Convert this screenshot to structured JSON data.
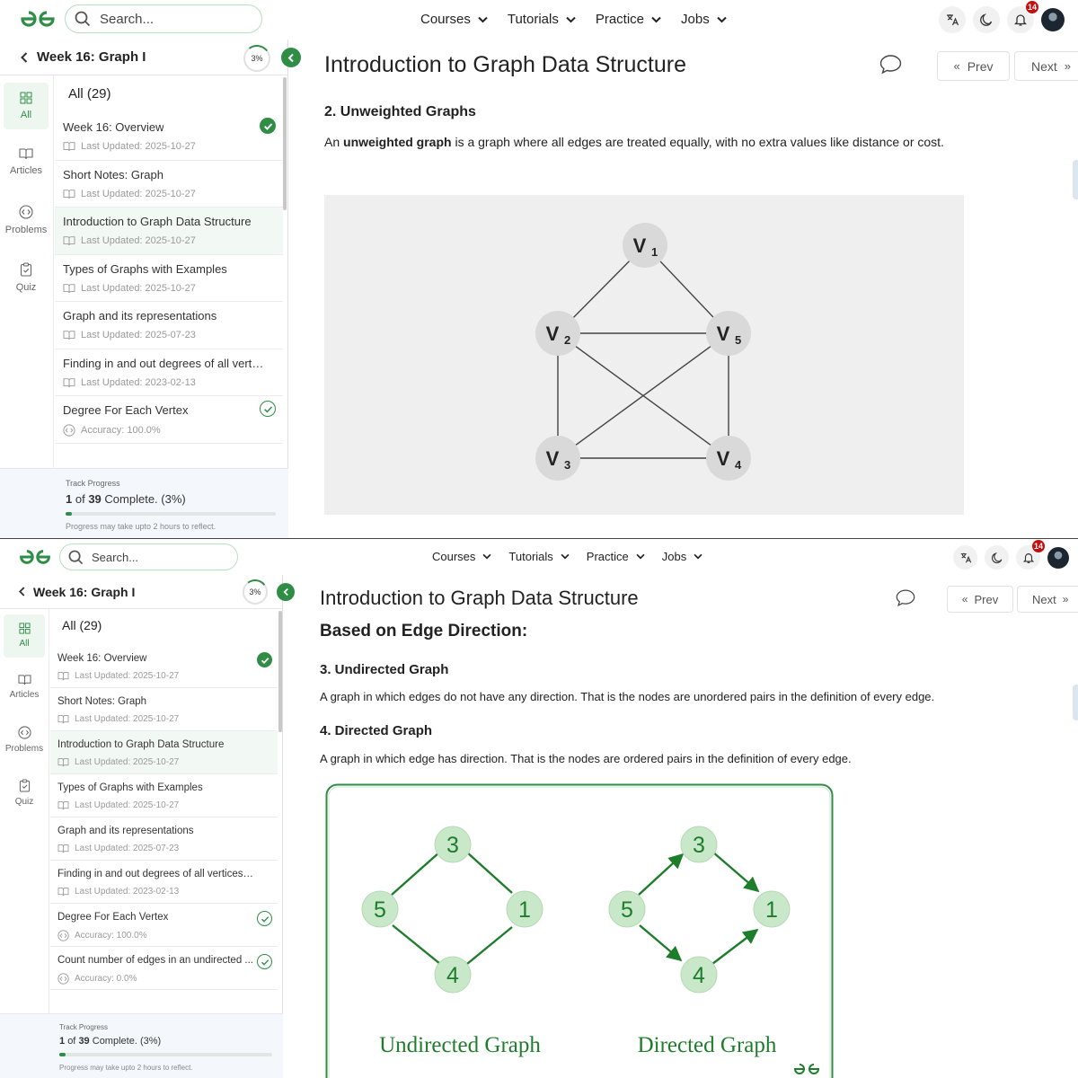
{
  "header": {
    "search_placeholder": "Search...",
    "nav": [
      "Courses",
      "Tutorials",
      "Practice",
      "Jobs"
    ],
    "notification_count": "14",
    "brand_color": "#2f8d46"
  },
  "sidebar": {
    "title": "Week 16: Graph I",
    "progress_percent": "3%",
    "rail": [
      "All",
      "Articles",
      "Problems",
      "Quiz"
    ],
    "all_label": "All (29)",
    "items_top": [
      {
        "title": "Week 16: Overview",
        "meta": "Last Updated: 2025-10-27",
        "icon": "book-icon",
        "status": "done"
      },
      {
        "title": "Short Notes: Graph",
        "meta": "Last Updated: 2025-10-27",
        "icon": "book-icon",
        "status": "none"
      },
      {
        "title": "Introduction to Graph Data Structure",
        "meta": "Last Updated: 2025-10-27",
        "icon": "book-icon",
        "status": "selected"
      },
      {
        "title": "Types of Graphs with Examples",
        "meta": "Last Updated: 2025-10-27",
        "icon": "book-icon",
        "status": "none"
      },
      {
        "title": "Graph and its representations",
        "meta": "Last Updated: 2025-07-23",
        "icon": "book-icon",
        "status": "none"
      },
      {
        "title": "Finding in and out degrees of all vertic...",
        "meta": "Last Updated: 2023-02-13",
        "icon": "book-icon",
        "status": "none"
      },
      {
        "title": "Degree For Each Vertex",
        "meta": "Accuracy: 100.0%",
        "icon": "code-icon",
        "status": "open"
      }
    ],
    "items_bottom": [
      {
        "title": "Week 16: Overview",
        "meta": "Last Updated: 2025-10-27",
        "icon": "book-icon",
        "status": "done"
      },
      {
        "title": "Short Notes: Graph",
        "meta": "Last Updated: 2025-10-27",
        "icon": "book-icon",
        "status": "none"
      },
      {
        "title": "Introduction to Graph Data Structure",
        "meta": "Last Updated: 2025-10-27",
        "icon": "book-icon",
        "status": "selected"
      },
      {
        "title": "Types of Graphs with Examples",
        "meta": "Last Updated: 2025-10-27",
        "icon": "book-icon",
        "status": "none"
      },
      {
        "title": "Graph and its representations",
        "meta": "Last Updated: 2025-07-23",
        "icon": "book-icon",
        "status": "none"
      },
      {
        "title": "Finding in and out degrees of all vertices in ...",
        "meta": "Last Updated: 2023-02-13",
        "icon": "book-icon",
        "status": "none"
      },
      {
        "title": "Degree For Each Vertex",
        "meta": "Accuracy: 100.0%",
        "icon": "code-icon",
        "status": "open"
      },
      {
        "title": "Count number of edges in an undirected ...",
        "meta": "Accuracy: 0.0%",
        "icon": "code-icon",
        "status": "open"
      }
    ],
    "track": {
      "label": "Track Progress",
      "done": "1",
      "of_word": "of",
      "total": "39",
      "complete_text": "Complete. (3%)",
      "fraction": 0.03,
      "note": "Progress may take upto 2 hours to reflect."
    }
  },
  "main": {
    "title": "Introduction to Graph Data Structure",
    "prev_label": "Prev",
    "next_label": "Next",
    "s1": {
      "heading": "2. Unweighted Graphs",
      "para_pre": "An ",
      "para_bold": "unweighted graph",
      "para_post": " is a graph where all edges are treated equally, with no extra values like distance or cost.",
      "graph_nodes": [
        "V",
        "V",
        "V",
        "V",
        "V"
      ],
      "graph_subs": [
        "1",
        "2",
        "5",
        "3",
        "4"
      ]
    },
    "s2": {
      "big_heading": "Based on Edge Direction:",
      "h_undirected": "3. Undirected Graph",
      "p_undirected": "A graph in which edges do not have any direction. That is the nodes are unordered pairs in the definition of every edge.",
      "h_directed": "4. Directed Graph",
      "p_directed": "A graph in which edge has direction. That is the nodes are ordered pairs in the definition of every edge.",
      "nodes": [
        "3",
        "5",
        "1",
        "4"
      ],
      "caption_left": "Undirected Graph",
      "caption_right": "Directed Graph"
    }
  }
}
